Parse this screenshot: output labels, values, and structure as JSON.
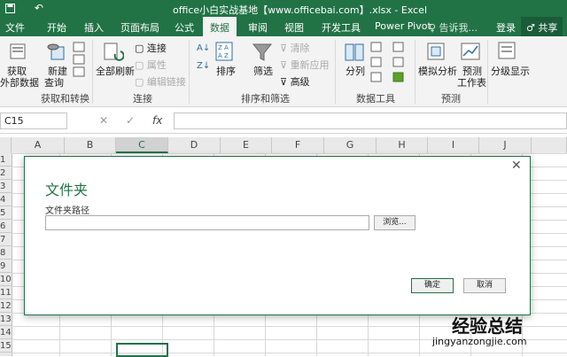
{
  "window": {
    "title": "office小白实战基地【www.officebai.com】.xlsx - Excel",
    "undo_label": "↶",
    "save_icon": "save-icon"
  },
  "tabs": [
    "文件",
    "开始",
    "插入",
    "页面布局",
    "公式",
    "数据",
    "审阅",
    "视图",
    "开发工具",
    "Power Pivot"
  ],
  "active_tab": "数据",
  "tell_me": "♀ 告诉我...",
  "login": "登录",
  "share": "♂ 共享",
  "ribbon": {
    "get_external": "获取\n外部数据",
    "get_external_l1": "获取",
    "get_external_l2": "外部数据",
    "new_query_l1": "新建",
    "new_query_l2": "查询",
    "group_get_transform": "获取和转换",
    "refresh_all": "全部刷新",
    "connections": "连接",
    "properties": "属性",
    "edit_links": "编辑链接",
    "group_connections": "连接",
    "sort": "排序",
    "filter": "筛选",
    "clear": "清除",
    "reapply": "重新应用",
    "advanced": "高级",
    "group_sort_filter": "排序和筛选",
    "text_to_columns": "分列",
    "group_data_tools": "数据工具",
    "what_if": "模拟分析",
    "forecast_l1": "预测",
    "forecast_l2": "工作表",
    "group_forecast": "预测",
    "outline": "分级显示"
  },
  "formula_bar": {
    "name_box": "C15",
    "cancel": "✕",
    "enter": "✓",
    "fx": "fx",
    "value": ""
  },
  "columns": [
    "A",
    "B",
    "C",
    "D",
    "E",
    "F",
    "G",
    "H",
    "I",
    "J"
  ],
  "selected_column": "C",
  "rows": [
    "1",
    "2",
    "3",
    "4",
    "5",
    "6",
    "7",
    "8",
    "9",
    "10",
    "11",
    "12",
    "13",
    "14",
    "15"
  ],
  "dialog": {
    "title": "文件夹",
    "path_label": "文件夹路径",
    "path_value": "",
    "browse": "浏览...",
    "ok": "确定",
    "cancel": "取消",
    "close": "✕"
  },
  "watermark": {
    "text": "经验总结",
    "url": "jingyanzongjie.com"
  },
  "colors": {
    "excel_green": "#217346"
  }
}
